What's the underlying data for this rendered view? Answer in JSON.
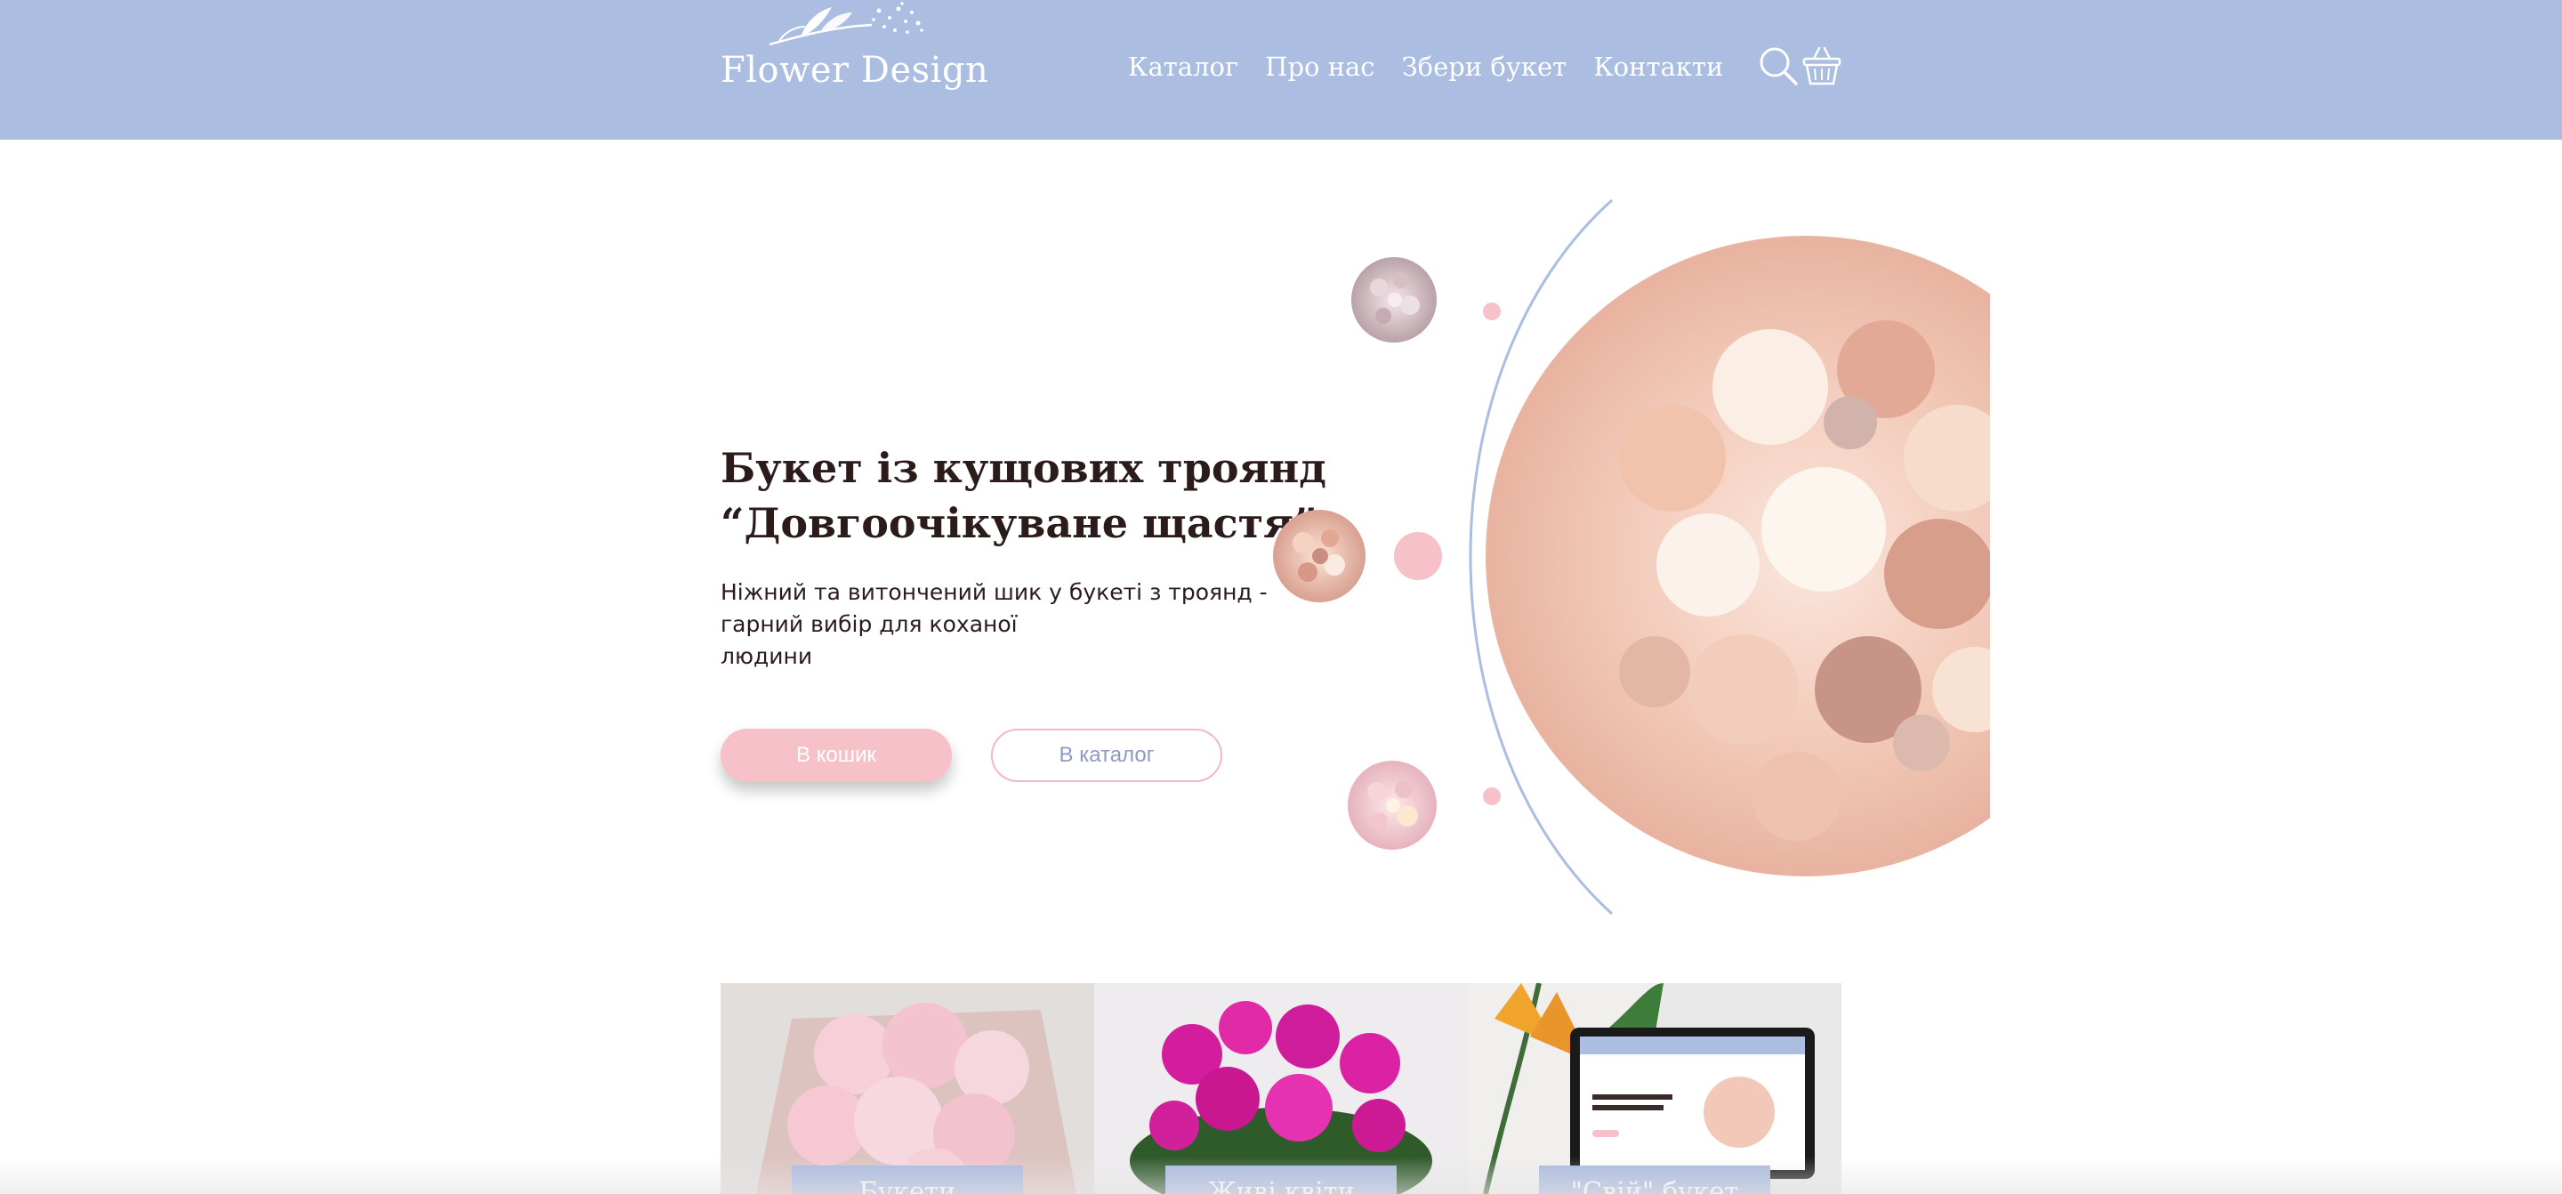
{
  "header": {
    "logo_text": "Flower Design",
    "bg_color": "#abbde0",
    "nav": [
      {
        "label": "Каталог"
      },
      {
        "label": "Про нас"
      },
      {
        "label": "Збери букет"
      },
      {
        "label": "Контакти"
      }
    ],
    "icons": [
      "search-icon",
      "basket-icon"
    ]
  },
  "hero": {
    "title_line1": "Букет із кущових троянд",
    "title_line2": "“Довгоочікуване щастя”",
    "desc_line1": "Ніжний та витончений шик у букеті з троянд -",
    "desc_line2": "гарний вибір для коханої",
    "desc_line3": "людини",
    "cart_button": "В кошик",
    "catalog_button": "В каталог"
  },
  "categories": [
    {
      "label": "Букети"
    },
    {
      "label": "Живі квіти"
    },
    {
      "label": "\"Свій\" букет"
    }
  ],
  "colors": {
    "accent_pink": "#f6c1c9",
    "accent_blue": "#abbde0",
    "text_dark": "#2b1b1b"
  }
}
